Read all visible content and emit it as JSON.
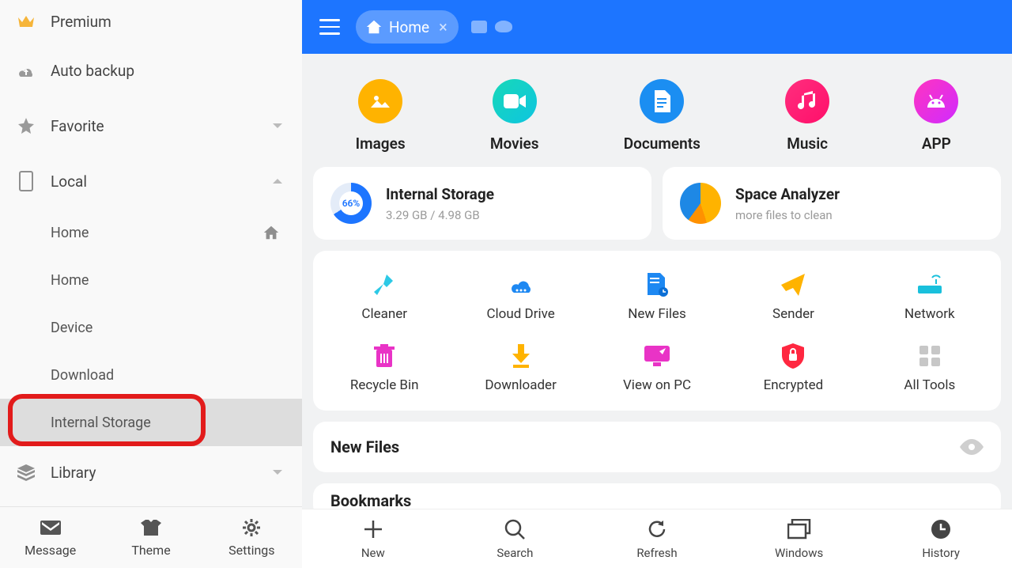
{
  "sidebar": {
    "premium": "Premium",
    "auto_backup": "Auto backup",
    "favorite": "Favorite",
    "local": "Local",
    "library": "Library",
    "sub": {
      "home1": "Home",
      "home2": "Home",
      "device": "Device",
      "download": "Download",
      "internal": "Internal Storage"
    },
    "bottom": {
      "message": "Message",
      "theme": "Theme",
      "settings": "Settings"
    }
  },
  "topbar": {
    "tab_label": "Home"
  },
  "quick": {
    "images": "Images",
    "movies": "Movies",
    "documents": "Documents",
    "music": "Music",
    "app": "APP"
  },
  "storage": {
    "title": "Internal Storage",
    "detail": "3.29 GB / 4.98 GB",
    "percent": "66%"
  },
  "analyzer": {
    "title": "Space Analyzer",
    "detail": "more files to clean"
  },
  "tools": {
    "cleaner": "Cleaner",
    "cloud": "Cloud Drive",
    "newfiles": "New Files",
    "sender": "Sender",
    "network": "Network",
    "recycle": "Recycle Bin",
    "downloader": "Downloader",
    "viewpc": "View on PC",
    "encrypted": "Encrypted",
    "alltools": "All Tools"
  },
  "sections": {
    "newfiles": "New Files",
    "bookmarks": "Bookmarks"
  },
  "bottombar": {
    "new": "New",
    "search": "Search",
    "refresh": "Refresh",
    "windows": "Windows",
    "history": "History"
  }
}
